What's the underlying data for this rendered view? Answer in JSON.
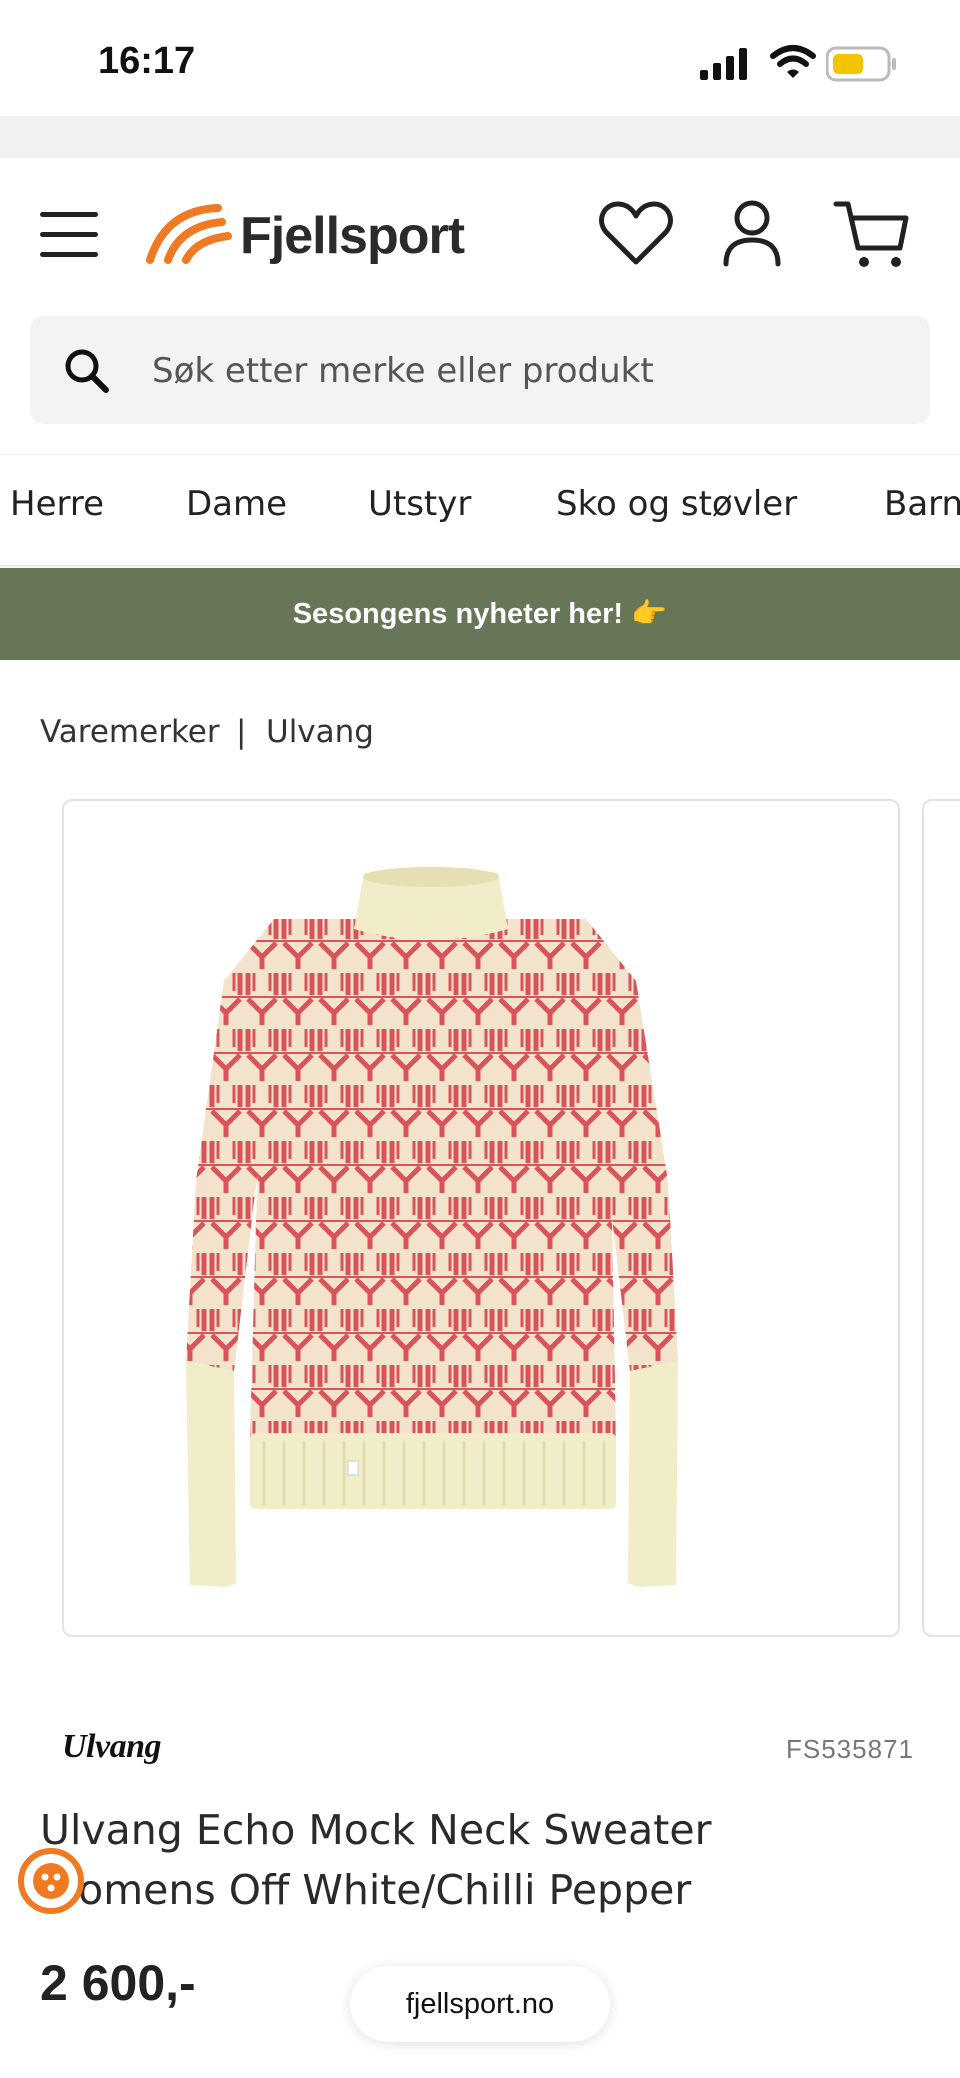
{
  "status_bar": {
    "time": "16:17"
  },
  "header": {
    "brand": "Fjellsport"
  },
  "search": {
    "placeholder": "Søk etter merke eller produkt"
  },
  "categories": [
    "Herre",
    "Dame",
    "Utstyr",
    "Sko og støvler",
    "Barn"
  ],
  "banner": {
    "text": "Sesongens nyheter her! 👉"
  },
  "breadcrumb": {
    "items": [
      "Varemerker",
      "Ulvang"
    ],
    "separator": "|"
  },
  "product": {
    "brand": "Ulvang",
    "sku": "FS535871",
    "title_line1": "Ulvang Echo Mock Neck Sweater",
    "title_line2": "Womens Off White/Chilli Pepper",
    "price": "2 600,-"
  },
  "browser": {
    "url": "fjellsport.no"
  },
  "colors": {
    "accent_orange": "#f07a22",
    "banner_green": "#667657",
    "sweater_red": "#d8545a",
    "sweater_cream": "#f3e8cf"
  }
}
